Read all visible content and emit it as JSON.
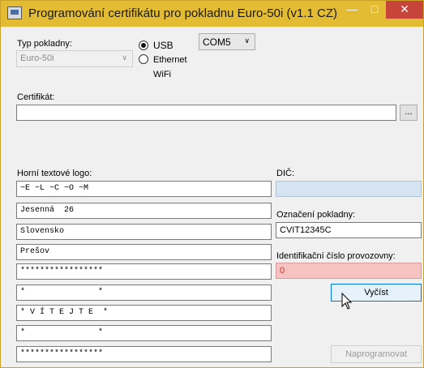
{
  "window": {
    "title": "Programování certifikátu pro pokladnu Euro-50i (v1.1 CZ)",
    "minimize": "—",
    "maximize": "□",
    "close": "✕"
  },
  "pokladna": {
    "label": "Typ pokladny:",
    "value": "Euro-50i"
  },
  "connection": {
    "usb": "USB",
    "ethernet": "Ethernet",
    "wifi": "WiFi",
    "port": "COM5"
  },
  "certifikat": {
    "label": "Certifikát:",
    "value": "",
    "browse": "..."
  },
  "logo": {
    "label": "Horní textové logo:",
    "lines": [
      "~E ~L ~C ~O ~M",
      "Jesenná  26",
      "Slovensko",
      "Prešov",
      "*****************",
      "*               *",
      "* V Í T E J T E  *",
      "*               *",
      "*****************"
    ]
  },
  "dic": {
    "label": "DIČ:",
    "value": ""
  },
  "oznaceni": {
    "label": "Označení pokladny:",
    "value": "CVIT12345C"
  },
  "provozovna": {
    "label": "Identifikační číslo provozovny:",
    "value": "0"
  },
  "buttons": {
    "vycist": "Vyčíst",
    "naprogramovat": "Naprogramovat"
  },
  "colors": {
    "titlebar": "#e3bc34",
    "close": "#c7443b",
    "dic_bg": "#d6e4f2",
    "error_bg": "#f7c2c2"
  }
}
